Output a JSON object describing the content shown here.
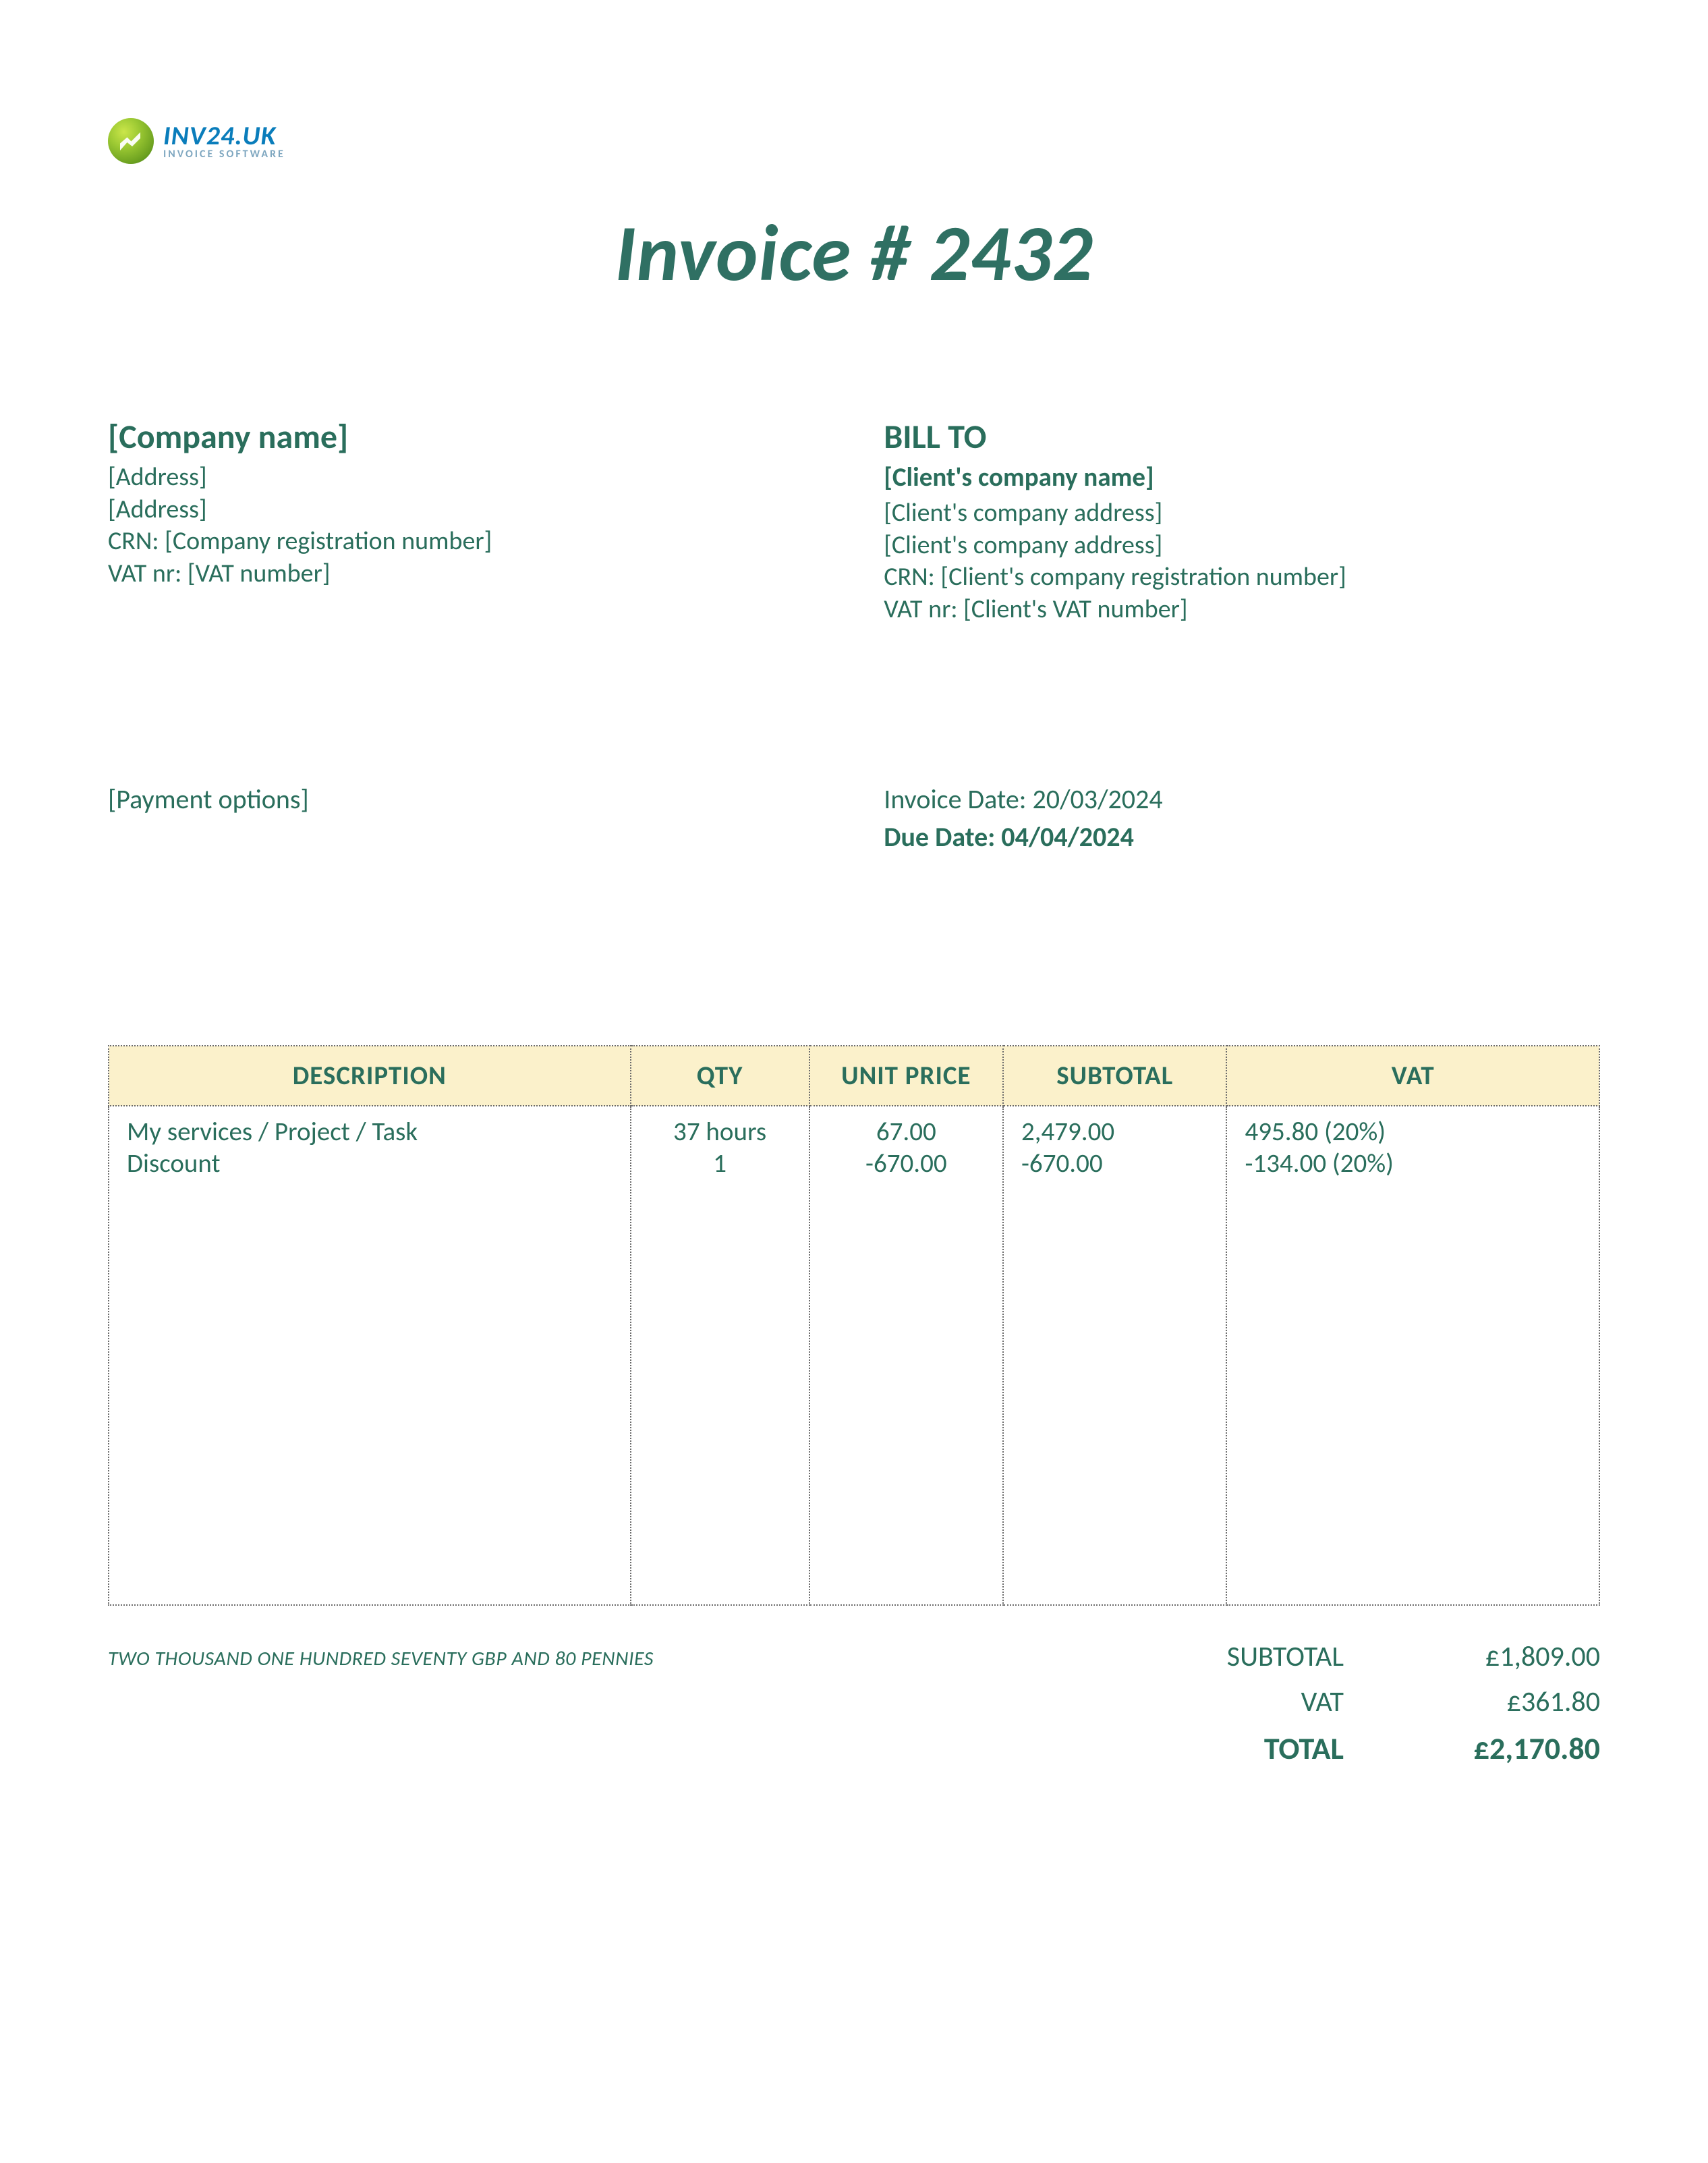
{
  "logo": {
    "primary": "INV24.UK",
    "sub": "INVOICE SOFTWARE"
  },
  "title": "Invoice # 2432",
  "seller": {
    "name": "[Company name]",
    "addr1": "[Address]",
    "addr2": "[Address]",
    "crn": "CRN: [Company registration number]",
    "vat": "VAT nr: [VAT number]"
  },
  "bill_to": {
    "heading": "BILL TO",
    "name": "[Client's company name]",
    "addr1": "[Client's company address]",
    "addr2": "[Client's company address]",
    "crn": "CRN: [Client's company registration number]",
    "vat": "VAT nr: [Client's VAT number]"
  },
  "payment_options": "[Payment options]",
  "dates": {
    "invoice_date": "Invoice Date: 20/03/2024",
    "due_date": "Due Date: 04/04/2024"
  },
  "columns": {
    "description": "DESCRIPTION",
    "qty": "QTY",
    "unit_price": "UNIT PRICE",
    "subtotal": "SUBTOTAL",
    "vat": "VAT"
  },
  "lines": [
    {
      "description": "My services / Project / Task",
      "qty": "37 hours",
      "unit_price": "67.00",
      "subtotal": "2,479.00",
      "vat": "495.80 (20%)"
    },
    {
      "description": "Discount",
      "qty": "1",
      "unit_price": "-670.00",
      "subtotal": "-670.00",
      "vat": "-134.00 (20%)"
    }
  ],
  "amount_words": "TWO THOUSAND  ONE HUNDRED SEVENTY GBP AND 80 PENNIES",
  "totals": {
    "subtotal_label": "SUBTOTAL",
    "subtotal_value": "£1,809.00",
    "vat_label": "VAT",
    "vat_value": "£361.80",
    "total_label": "TOTAL",
    "total_value": "£2,170.80"
  }
}
